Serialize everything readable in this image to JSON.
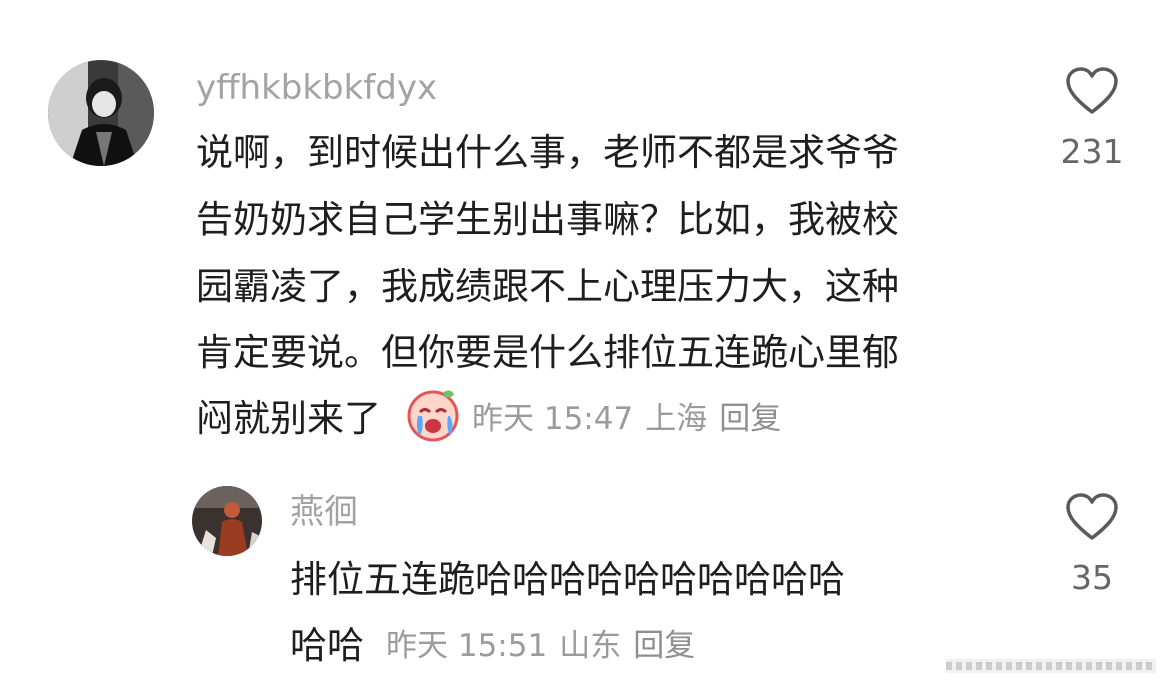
{
  "comments": [
    {
      "username": "yffhkbkbkfdyx",
      "text_lines": [
        "说啊，到时候出什么事，老师不都是求爷爷",
        "告奶奶求自己学生别出事嘛？比如，我被校",
        "园霸凌了，我成绩跟不上心理压力大，这种",
        "肯定要说。但你要是什么排位五连跪心里郁",
        "闷就别来了"
      ],
      "emoji": "crying-face",
      "time": "昨天 15:47",
      "location": "上海",
      "reply_label": "回复",
      "like_count": "231"
    },
    {
      "username": "燕徊",
      "text_lines": [
        "排位五连跪哈哈哈哈哈哈哈哈哈哈",
        "哈哈"
      ],
      "time": "昨天 15:51",
      "location": "山东",
      "reply_label": "回复",
      "like_count": "35"
    }
  ],
  "icons": {
    "like": "heart-outline-icon",
    "emoji": "crying-face-icon"
  },
  "colors": {
    "username": "#a3a3a3",
    "text": "#1e1e1e",
    "meta": "#9b9b9b",
    "like_count": "#666666"
  }
}
